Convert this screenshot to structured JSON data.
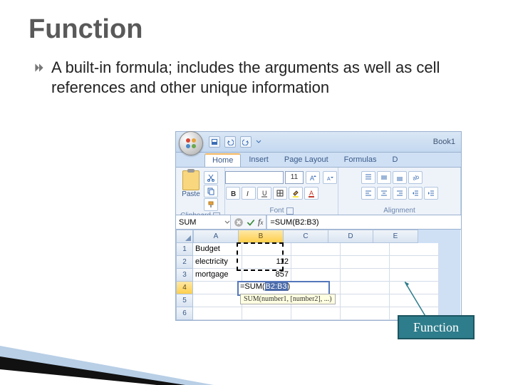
{
  "slide": {
    "title": "Function",
    "bullet": "A built-in formula; includes the arguments as well as cell references and other unique information"
  },
  "excel": {
    "book_title": "Book1",
    "tabs": [
      "Home",
      "Insert",
      "Page Layout",
      "Formulas",
      "D"
    ],
    "active_tab": "Home",
    "ribbon": {
      "paste_label": "Paste",
      "clipboard_label": "Clipboard",
      "font_size": "11",
      "font_label": "Font",
      "alignment_label": "Alignment"
    },
    "name_box": "SUM",
    "formula_bar": "=SUM(B2:B3)",
    "columns": [
      "A",
      "B",
      "C",
      "D",
      "E"
    ],
    "rows": [
      {
        "n": "1",
        "cells": [
          "Budget",
          "",
          "",
          "",
          ""
        ]
      },
      {
        "n": "2",
        "cells": [
          "electricity",
          "112",
          "",
          "",
          ""
        ]
      },
      {
        "n": "3",
        "cells": [
          "mortgage",
          "857",
          "",
          "",
          ""
        ]
      },
      {
        "n": "4",
        "cells": [
          "",
          "",
          "",
          "",
          ""
        ]
      },
      {
        "n": "5",
        "cells": [
          "",
          "",
          "",
          "",
          ""
        ]
      },
      {
        "n": "6",
        "cells": [
          "",
          "",
          "",
          "",
          ""
        ]
      }
    ],
    "active_row": "4",
    "active_col": "B",
    "editing_formula_prefix": "=SUM(",
    "editing_formula_ref": "B2:B3",
    "editing_formula_suffix": ")",
    "tooltip": "SUM(number1, [number2], ...)"
  },
  "callout": {
    "label": "Function"
  }
}
